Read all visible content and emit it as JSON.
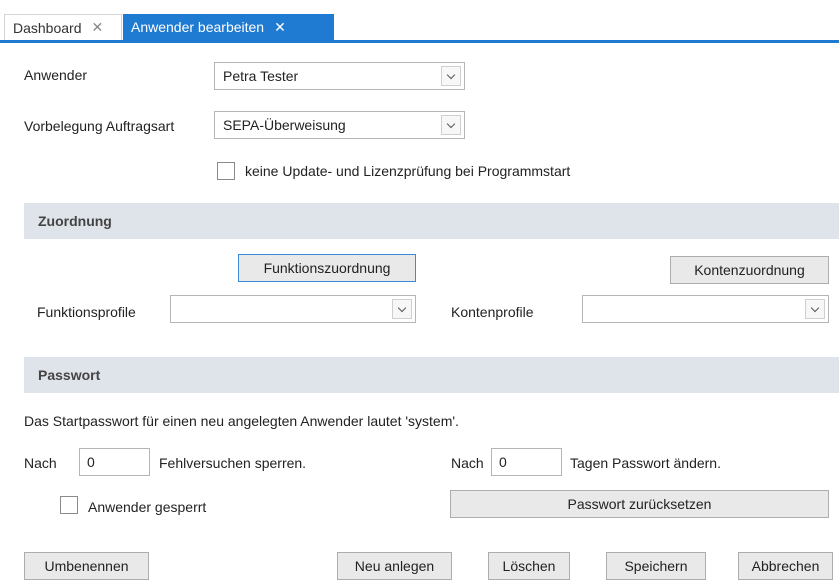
{
  "tabs": [
    {
      "label": "Dashboard",
      "close": "✕"
    },
    {
      "label": "Anwender bearbeiten",
      "close": "✕"
    }
  ],
  "form": {
    "anwender_label": "Anwender",
    "anwender_value": "Petra Tester",
    "auftragsart_label": "Vorbelegung Auftragsart",
    "auftragsart_value": "SEPA-Überweisung",
    "no_update_check_label": "keine Update- und Lizenzprüfung bei Programmstart",
    "no_update_check_checked": false
  },
  "zuordnung": {
    "title": "Zuordnung",
    "funktionszuordnung_button": "Funktionszuordnung",
    "kontenzuordnung_button": "Kontenzuordnung",
    "funktionsprofile_label": "Funktionsprofile",
    "funktionsprofile_value": "",
    "kontenprofile_label": "Kontenprofile",
    "kontenprofile_value": ""
  },
  "passwort": {
    "title": "Passwort",
    "info_text": "Das Startpasswort für einen neu angelegten Anwender lautet 'system'.",
    "nach_label_1": "Nach",
    "fehlversuche_value": "0",
    "fehlversuche_suffix": "Fehlversuchen sperren.",
    "nach_label_2": "Nach",
    "tage_value": "0",
    "tage_suffix": "Tagen Passwort ändern.",
    "gesperrt_label": "Anwender gesperrt",
    "gesperrt_checked": false,
    "reset_button": "Passwort zurücksetzen"
  },
  "footer": {
    "umbenennen": "Umbenennen",
    "neu_anlegen": "Neu anlegen",
    "loeschen": "Löschen",
    "speichern": "Speichern",
    "abbrechen": "Abbrechen"
  },
  "colors": {
    "accent": "#1f7ad1",
    "section_bg": "#dfe4ea"
  }
}
